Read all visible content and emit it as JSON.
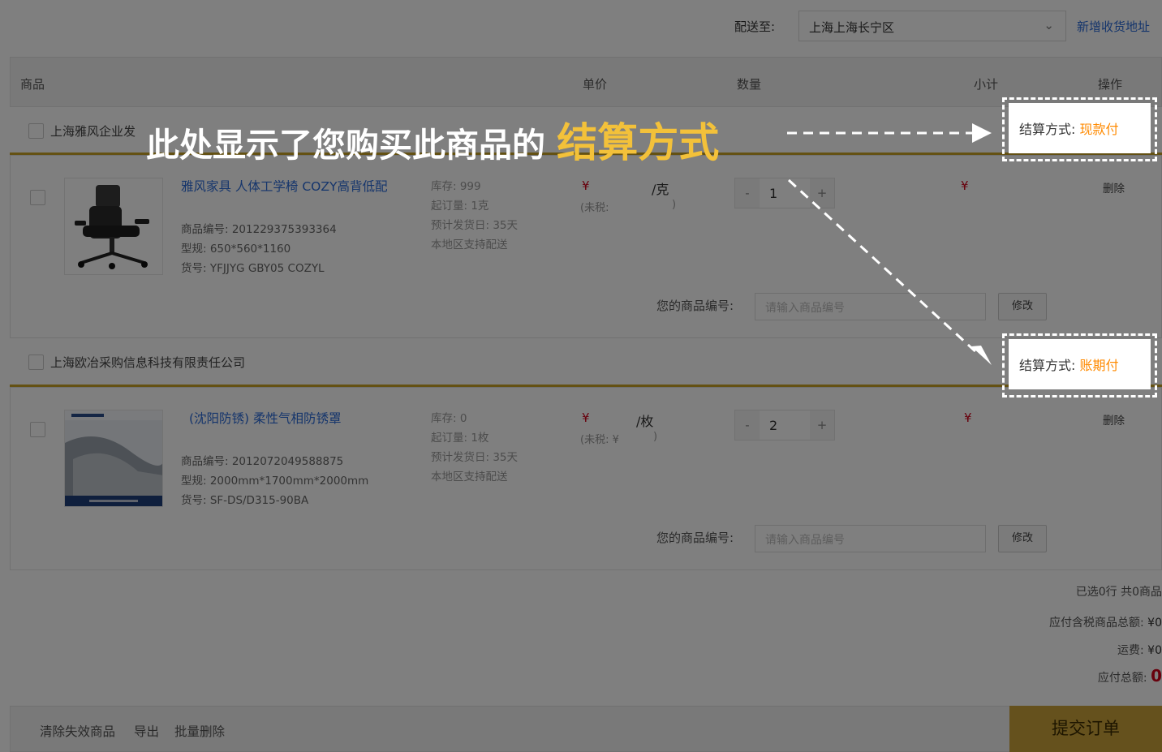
{
  "header": {
    "ship_to_label": "配送至:",
    "address_value": "上海上海长宁区",
    "new_address_link": "新增收货地址"
  },
  "columns": [
    "商品",
    "单价",
    "数量",
    "小计",
    "操作"
  ],
  "stores": [
    {
      "name": "上海雅风企业发",
      "settlement_label": "结算方式:",
      "settlement_value": "现款付",
      "item": {
        "title": "雅风家具 人体工学椅 COZY高背低配",
        "code": "商品编号: 201229375393364",
        "spec": "型规: 650*560*1160",
        "sku": "货号: YFJJYG GBY05 COZYL",
        "stock": "库存: 999",
        "moq": "起订量: 1克",
        "ship_date": "预计发货日: 35天",
        "local": "本地区支持配送",
        "price_symbol": "¥",
        "unit": "/克",
        "no_tax_open": "(未税:",
        "no_tax_close": ")",
        "quantity": "1",
        "subtotal_symbol": "¥",
        "delete": "删除",
        "code_label": "您的商品编号:",
        "code_placeholder": "请输入商品编号",
        "modify": "修改"
      }
    },
    {
      "name": "上海欧冶采购信息科技有限责任公司",
      "settlement_label": "结算方式:",
      "settlement_value": "账期付",
      "item": {
        "title": "(沈阳防锈) 柔性气相防锈罩",
        "code": "商品编号: 2012072049588875",
        "spec": "型规: 2000mm*1700mm*2000mm",
        "sku": "货号: SF-DS/D315-90BA",
        "stock": "库存: 0",
        "moq": "起订量: 1枚",
        "ship_date": "预计发货日: 35天",
        "local": "本地区支持配送",
        "price_symbol": "¥",
        "unit": "/枚",
        "no_tax_open": "(未税: ¥",
        "no_tax_close": ")",
        "quantity": "2",
        "subtotal_symbol": "¥",
        "delete": "删除",
        "code_label": "您的商品编号:",
        "code_placeholder": "请输入商品编号",
        "modify": "修改"
      }
    }
  ],
  "summary": {
    "selected": "已选0行  共0商品",
    "goods_total_label": "应付含税商品总额:",
    "goods_total": "¥0",
    "freight_label": "运费:",
    "freight": "¥0",
    "total_label": "应付总额:",
    "total": "0"
  },
  "footer": {
    "clear_invalid": "清除失效商品",
    "export": "导出",
    "batch_delete": "批量删除",
    "submit": "提交订单"
  },
  "callout": {
    "text": "此处显示了您购买此商品的",
    "highlight": "结算方式"
  },
  "colors": {
    "accent_gold": "#c9a227",
    "link_blue": "#2a6ad8",
    "price_red": "#d0021b",
    "settlement_orange": "#ff8a00",
    "callout_yellow": "#f3c13a"
  }
}
